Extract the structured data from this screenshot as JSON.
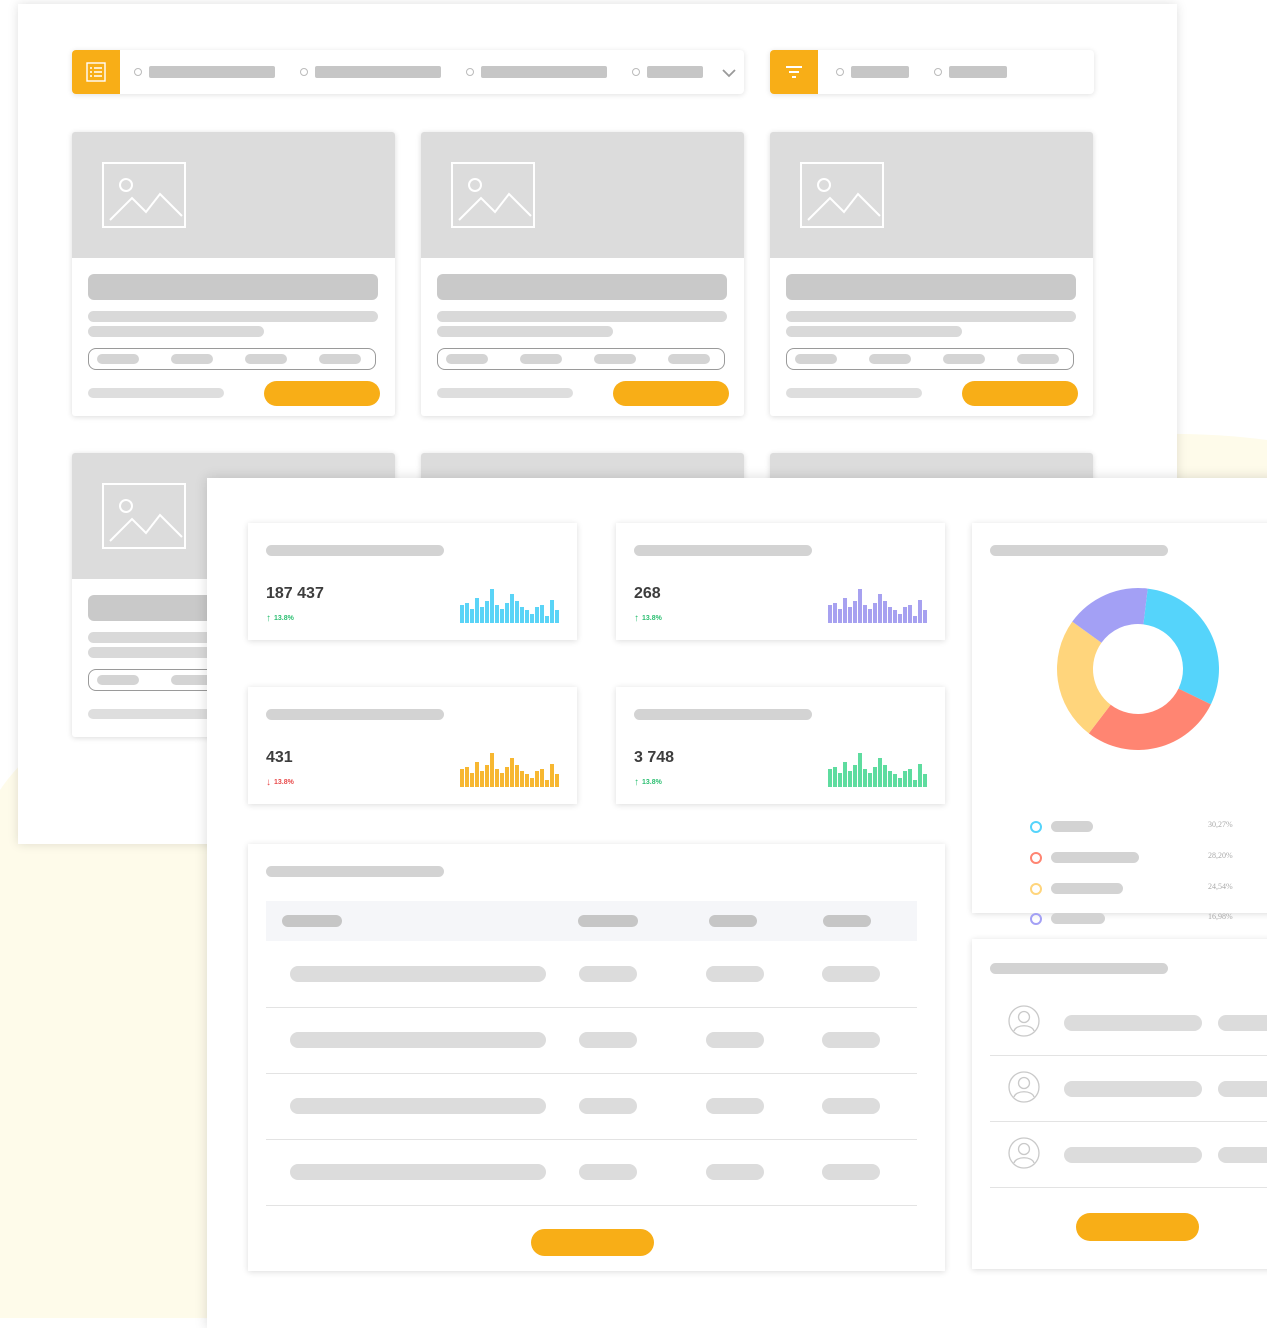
{
  "theme": {
    "accent": "#f8ae17",
    "up_color": "#2bbf71",
    "down_color": "#e84a4a"
  },
  "catalog_window": {
    "view_toolbar": {
      "icon": "list-icon",
      "has_dropdown": true,
      "dropdown_icon": "chevron-down-icon"
    },
    "filter_toolbar": {
      "icon": "filter-icon"
    },
    "product_card": {
      "image_icon": "image-icon"
    }
  },
  "dashboard_window": {
    "stats": [
      {
        "value": "187 437",
        "delta": "13.8%",
        "trend": "up",
        "spark_color": "#5ad4f7"
      },
      {
        "value": "268",
        "delta": "13.8%",
        "trend": "up",
        "spark_color": "#a7a1f0"
      },
      {
        "value": "431",
        "delta": "13.8%",
        "trend": "down",
        "spark_color": "#f7b731"
      },
      {
        "value": "3 748",
        "delta": "13.8%",
        "trend": "up",
        "spark_color": "#5edc9f"
      }
    ],
    "donut": {
      "segments": [
        {
          "color": "#55d4fb",
          "percent_label": "30,27%"
        },
        {
          "color": "#ff8572",
          "percent_label": "28,20%"
        },
        {
          "color": "#ffd57c",
          "percent_label": "24,54%"
        },
        {
          "color": "#a3a0f5",
          "percent_label": "16,98%"
        }
      ]
    },
    "users": {
      "avatar_icon": "user-icon"
    }
  }
}
